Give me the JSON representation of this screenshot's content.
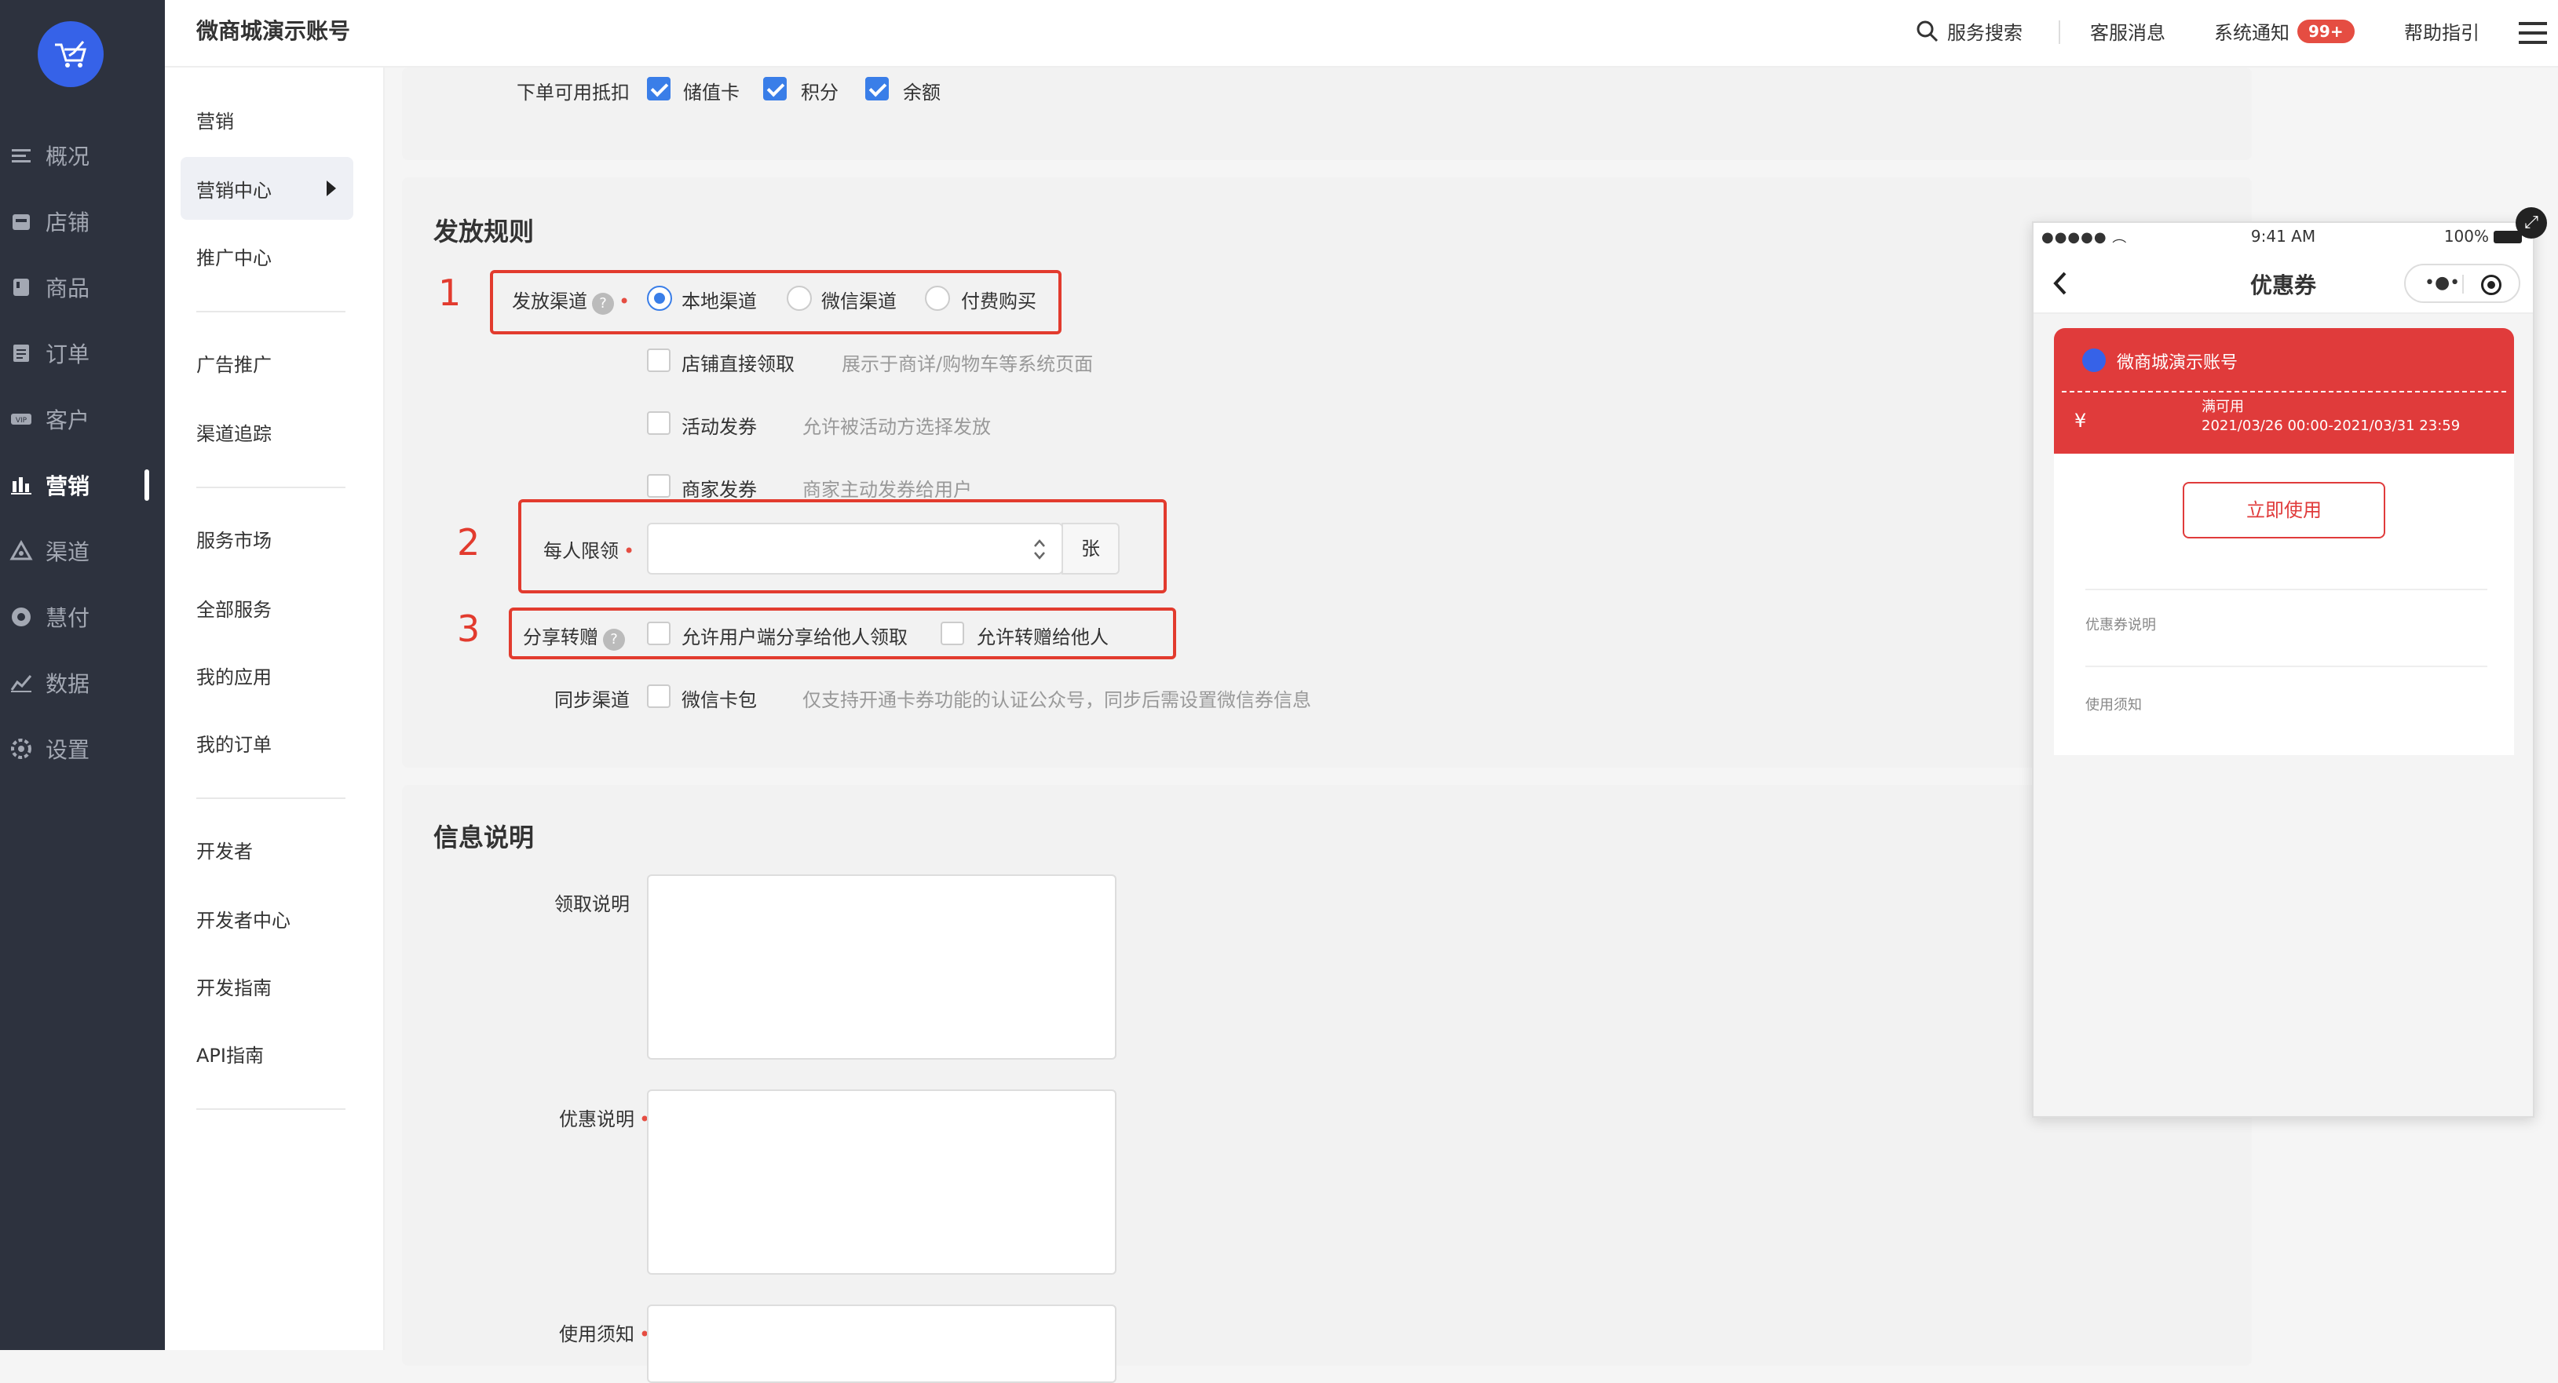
{
  "colors": {
    "accent": "#3a7ee8",
    "highlight": "#e23b2e",
    "coupon": "#e03b3b",
    "sidebar": "#2d323e"
  },
  "sidebar": {
    "items": [
      {
        "label": "概况",
        "icon": "menu-icon"
      },
      {
        "label": "店铺",
        "icon": "shop-icon"
      },
      {
        "label": "商品",
        "icon": "product-icon"
      },
      {
        "label": "订单",
        "icon": "order-icon"
      },
      {
        "label": "客户",
        "icon": "vip-icon"
      },
      {
        "label": "营销",
        "icon": "bar-chart-icon",
        "active": true
      },
      {
        "label": "渠道",
        "icon": "channel-icon"
      },
      {
        "label": "慧付",
        "icon": "pay-icon"
      },
      {
        "label": "数据",
        "icon": "data-icon"
      },
      {
        "label": "设置",
        "icon": "gear-icon"
      }
    ]
  },
  "header": {
    "title": "微商城演示账号",
    "search": "服务搜索",
    "messages": "客服消息",
    "notify": "系统通知",
    "notify_badge": "99+",
    "help": "帮助指引"
  },
  "subnav": {
    "marketing": "营销",
    "marketing_center": "营销中心",
    "promo_center": "推广中心",
    "ad": "广告推广",
    "channel_track": "渠道追踪",
    "service_market": "服务市场",
    "all_services": "全部服务",
    "my_apps": "我的应用",
    "my_orders": "我的订单",
    "developer": "开发者",
    "dev_center": "开发者中心",
    "dev_guide": "开发指南",
    "api_guide": "API指南"
  },
  "form": {
    "deduct_label": "下单可用抵扣",
    "deduct_options": [
      "储值卡",
      "积分",
      "余额"
    ],
    "rules_title": "发放规则",
    "channel_label": "发放渠道",
    "channel_options": [
      "本地渠道",
      "微信渠道",
      "付费购买"
    ],
    "sub_options": [
      {
        "label": "店铺直接领取",
        "hint": "展示于商详/购物车等系统页面"
      },
      {
        "label": "活动发券",
        "hint": "允许被活动方选择发放"
      },
      {
        "label": "商家发券",
        "hint": "商家主动发券给用户"
      }
    ],
    "limit_label": "每人限领",
    "limit_value": "",
    "limit_unit": "张",
    "share_label": "分享转赠",
    "share_options": [
      "允许用户端分享给他人领取",
      "允许转赠给他人"
    ],
    "sync_label": "同步渠道",
    "sync_option": "微信卡包",
    "sync_hint": "仅支持开通卡券功能的认证公众号，同步后需设置微信券信息",
    "info_title": "信息说明",
    "receive_label": "领取说明",
    "discount_label": "优惠说明",
    "notice_label": "使用须知"
  },
  "annotations": [
    "1",
    "2",
    "3"
  ],
  "phone": {
    "time": "9:41 AM",
    "battery": "100%",
    "title": "优惠券",
    "shop": "微商城演示账号",
    "currency": "¥",
    "condition": "满可用",
    "period": "2021/03/26 00:00-2021/03/31 23:59",
    "use_button": "立即使用",
    "desc": "优惠券说明",
    "notice": "使用须知"
  }
}
